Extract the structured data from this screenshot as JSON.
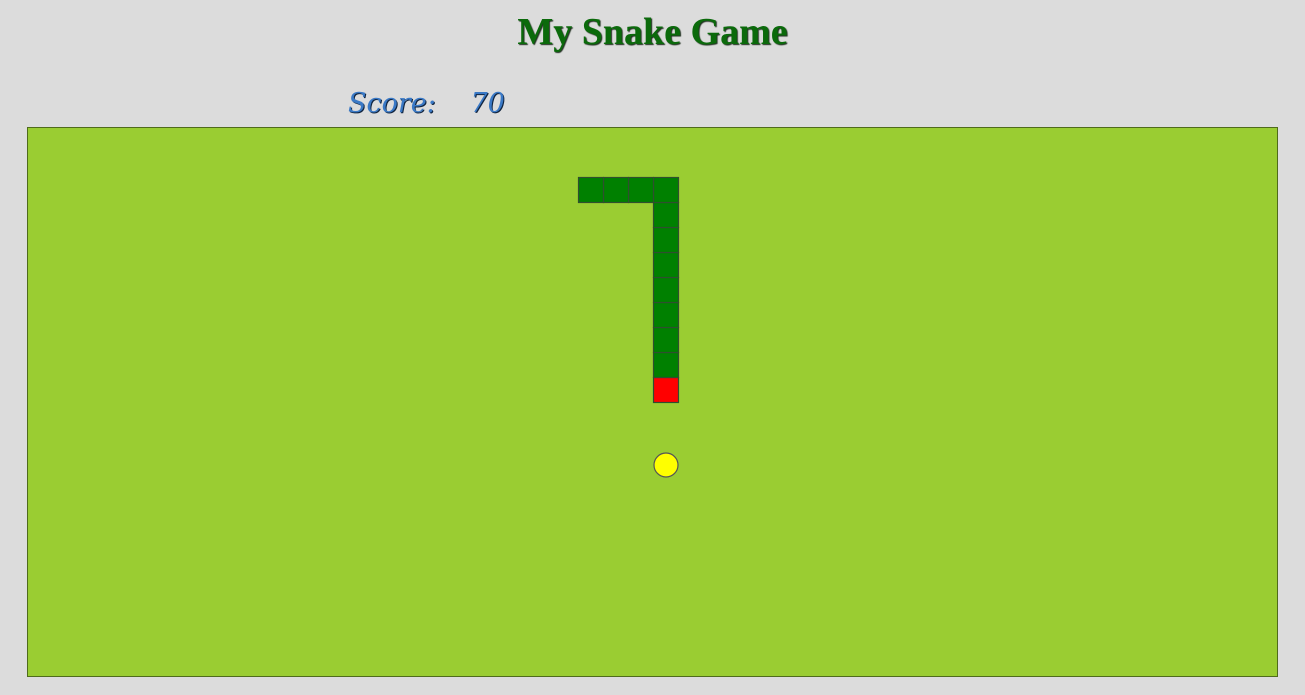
{
  "header": {
    "title": "My Snake Game"
  },
  "score": {
    "label": "Score:",
    "value": "70"
  },
  "board": {
    "colors": {
      "background": "#9acd32",
      "snake_body": "#008000",
      "snake_head": "#ff0000",
      "food": "#ffff00",
      "outline": "#2f4f2f"
    },
    "grid_cols": 50,
    "grid_rows": 22,
    "snake": [
      {
        "col": 25,
        "row": 10,
        "part": "head"
      },
      {
        "col": 25,
        "row": 9,
        "part": "body"
      },
      {
        "col": 25,
        "row": 8,
        "part": "body"
      },
      {
        "col": 25,
        "row": 7,
        "part": "body"
      },
      {
        "col": 25,
        "row": 6,
        "part": "body"
      },
      {
        "col": 25,
        "row": 5,
        "part": "body"
      },
      {
        "col": 25,
        "row": 4,
        "part": "body"
      },
      {
        "col": 25,
        "row": 3,
        "part": "body"
      },
      {
        "col": 25,
        "row": 2,
        "part": "body"
      },
      {
        "col": 24,
        "row": 2,
        "part": "body"
      },
      {
        "col": 23,
        "row": 2,
        "part": "body"
      },
      {
        "col": 22,
        "row": 2,
        "part": "body"
      }
    ],
    "food": {
      "col": 25,
      "row": 13
    }
  }
}
